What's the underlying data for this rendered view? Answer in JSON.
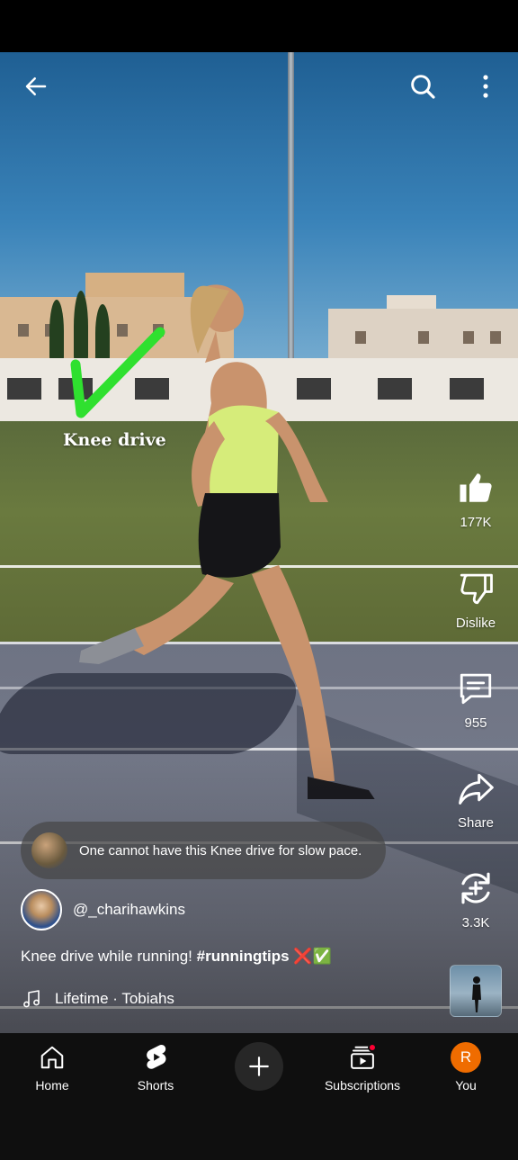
{
  "video": {
    "overlay_caption": "Knee drive"
  },
  "actions": {
    "like_count": "177K",
    "dislike_label": "Dislike",
    "comment_count": "955",
    "share_label": "Share",
    "remix_count": "3.3K"
  },
  "comment_preview": {
    "text": "One cannot have this Knee drive for slow pace."
  },
  "channel": {
    "handle": "@_charihawkins"
  },
  "title": {
    "text": "Knee drive while running! ",
    "hashtag": "#runningtips",
    "emoji": " ❌✅"
  },
  "music": {
    "track": "Lifetime · Tobiahs"
  },
  "nav": {
    "home": "Home",
    "shorts": "Shorts",
    "subscriptions": "Subscriptions",
    "you": "You",
    "you_initial": "R"
  },
  "icons": {
    "back": "arrow-left-icon",
    "search": "search-icon",
    "more": "more-vertical-icon",
    "like": "thumbs-up-icon",
    "dislike": "thumbs-down-icon",
    "comment": "comment-icon",
    "share": "share-icon",
    "remix": "remix-icon",
    "music": "music-note-icon"
  },
  "colors": {
    "notification_dot": "#ff0033",
    "you_avatar": "#ef6c00",
    "nav_background": "#0f0f0f"
  }
}
